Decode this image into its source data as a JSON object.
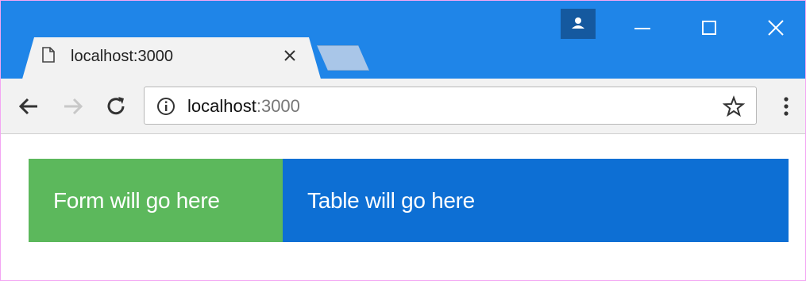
{
  "window": {
    "tab": {
      "title": "localhost:3000",
      "icon": "page-icon",
      "close_icon": "close-icon"
    },
    "new_tab_icon": "new-tab-icon",
    "profile_icon": "person-icon",
    "controls": {
      "minimize_icon": "minimize-icon",
      "maximize_icon": "maximize-icon",
      "close_icon": "close-icon"
    }
  },
  "toolbar": {
    "back_icon": "back-arrow-icon",
    "forward_icon": "forward-arrow-icon",
    "reload_icon": "reload-icon",
    "address": {
      "host": "localhost",
      "port": ":3000",
      "security_icon": "info-icon"
    },
    "bookmark_icon": "star-icon",
    "menu_icon": "menu-dots-icon"
  },
  "page": {
    "form_placeholder": "Form will go here",
    "table_placeholder": "Table will go here"
  },
  "colors": {
    "titlebar": "#1f85e8",
    "form_panel": "#5cb85c",
    "table_panel": "#0d6fd4"
  }
}
